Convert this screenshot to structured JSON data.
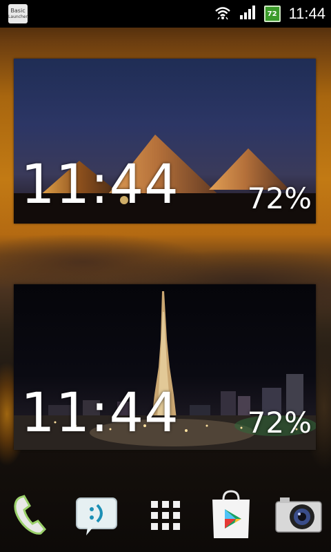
{
  "status_bar": {
    "notification_icon_label_line1": "Basic",
    "notification_icon_label_line2": "Launcher",
    "wifi_icon": "wifi-icon",
    "signal_icon": "signal-icon",
    "battery_level": "72",
    "clock": "11:44"
  },
  "widgets": [
    {
      "name": "pyramids-clock-widget",
      "time": "11:44",
      "battery": "72%",
      "background": "pyramids-night-photo"
    },
    {
      "name": "dubai-clock-widget",
      "time": "11:44",
      "battery": "72%",
      "background": "burj-khalifa-night-photo"
    }
  ],
  "dock": {
    "items": [
      {
        "name": "phone-icon"
      },
      {
        "name": "messaging-icon"
      },
      {
        "name": "app-drawer-icon"
      },
      {
        "name": "play-store-icon"
      },
      {
        "name": "camera-icon"
      }
    ]
  },
  "colors": {
    "battery_green": "#3b9b2a",
    "play_store_bag": "#f4f4f4",
    "sky_orange": "#c27a14"
  }
}
